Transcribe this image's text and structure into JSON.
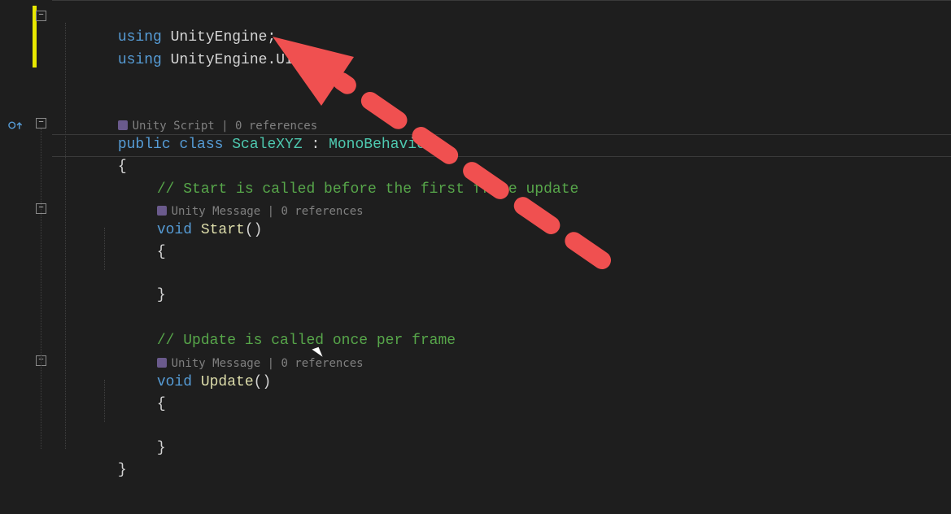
{
  "code": {
    "using1_kw": "using",
    "using1_ns": " UnityEngine",
    "using1_end": ";",
    "using2_kw": "using",
    "using2_ns": " UnityEngine.UI",
    "using2_end": ";",
    "codelens_class": "Unity Script | 0 references",
    "class_public": "public ",
    "class_kw": "class ",
    "class_name": "ScaleXYZ",
    "class_colon": " : ",
    "class_base": "MonoBehaviour",
    "brace_open": "{",
    "comment_start": "// Start is called before the first frame update",
    "codelens_start": "Unity Message | 0 references",
    "start_void": "void ",
    "start_name": "Start",
    "start_parens": "()",
    "start_brace_open": "{",
    "start_brace_close": "}",
    "comment_update": "// Update is called once per frame",
    "codelens_update": "Unity Message | 0 references",
    "update_void": "void ",
    "update_name": "Update",
    "update_parens": "()",
    "update_brace_open": "{",
    "update_brace_close": "}",
    "brace_close": "}"
  },
  "annotation": {
    "color": "#f05050"
  }
}
